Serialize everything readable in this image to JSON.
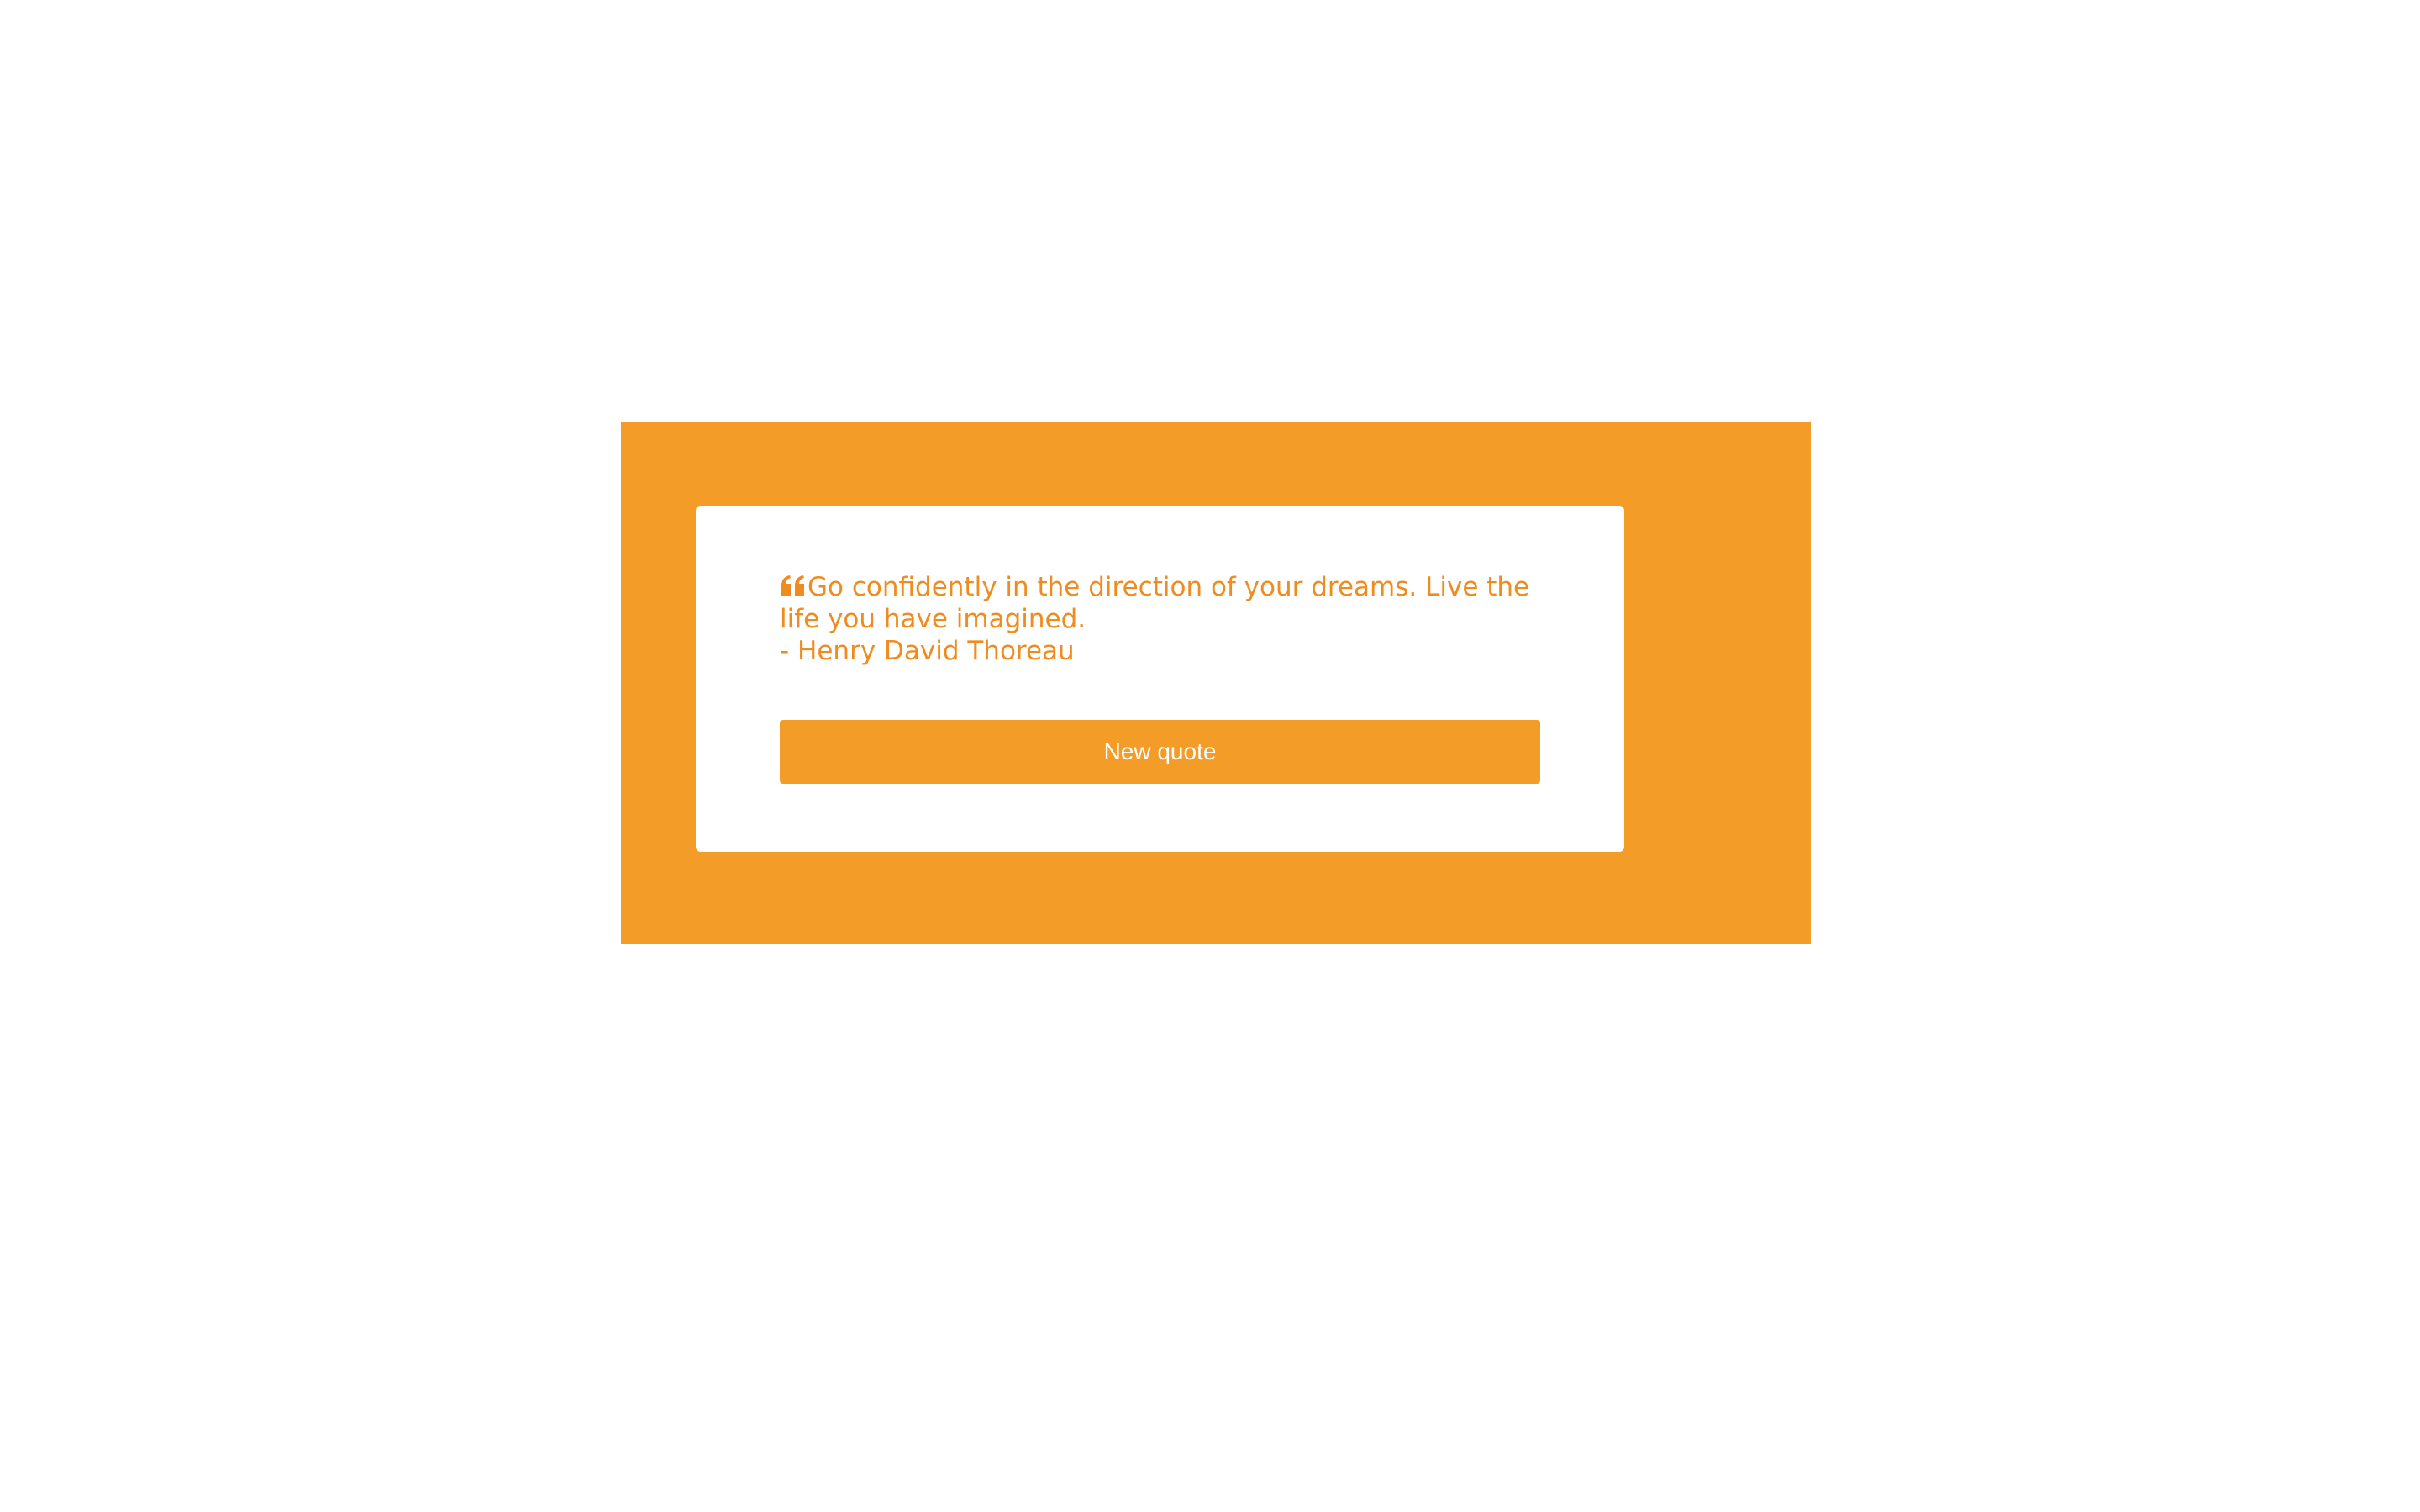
{
  "quote": {
    "text": "Go confidently in the direction of your dreams. Live the life you have imagined.",
    "author": "- Henry David Thoreau",
    "icon": "quote-left-icon"
  },
  "actions": {
    "new_quote_label": "New quote"
  },
  "colors": {
    "accent": "#f49c28",
    "text": "#f08c1f",
    "card": "#ffffff",
    "page": "#ffffff"
  }
}
